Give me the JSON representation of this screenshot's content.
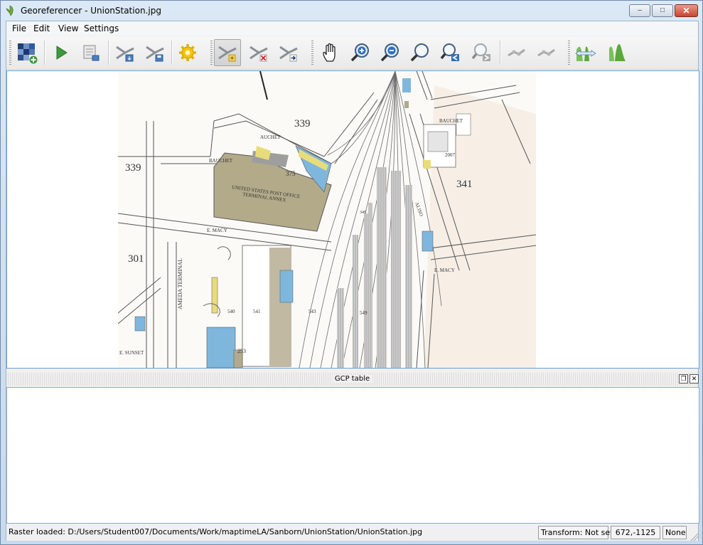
{
  "window": {
    "title": "Georeferencer - UnionStation.jpg",
    "controls": {
      "minimize": "‒",
      "maximize": "□",
      "close": "✕"
    }
  },
  "menubar": {
    "items": [
      "File",
      "Edit",
      "View",
      "Settings"
    ]
  },
  "toolbar": {
    "buttons": [
      {
        "icon": "open-raster-icon"
      },
      {
        "icon": "start-georeferencing-icon"
      },
      {
        "icon": "generate-gdal-script-icon"
      },
      {
        "icon": "load-gcp-points-icon"
      },
      {
        "icon": "save-gcp-points-icon"
      },
      {
        "icon": "transformation-settings-icon"
      },
      {
        "icon": "add-point-icon",
        "active": true
      },
      {
        "icon": "delete-point-icon"
      },
      {
        "icon": "move-gcp-point-icon"
      },
      {
        "icon": "pan-icon"
      },
      {
        "icon": "zoom-in-icon"
      },
      {
        "icon": "zoom-out-icon"
      },
      {
        "icon": "zoom-to-layer-icon"
      },
      {
        "icon": "zoom-last-icon"
      },
      {
        "icon": "zoom-next-icon"
      },
      {
        "icon": "link-georeferencer-to-qgis-icon"
      },
      {
        "icon": "link-qgis-to-georeferencer-icon"
      },
      {
        "icon": "full-histogram-stretch-icon"
      },
      {
        "icon": "local-histogram-stretch-icon"
      }
    ]
  },
  "map": {
    "labels": [
      "339",
      "339",
      "341",
      "301",
      "BAUCHET",
      "AUCHET",
      "BAUCHET",
      "UNITED STATES POST OFFICE",
      "TERMINAL ANNEX",
      "375",
      "E. MACY",
      "2007",
      "ALISO",
      "253",
      "349",
      "540",
      "541",
      "543",
      "549",
      "AMEDA TERMINAL",
      "E. SUNSET",
      "E. MACY"
    ]
  },
  "dock": {
    "title": "GCP table",
    "float_glyph": "❐",
    "close_glyph": "✕"
  },
  "status": {
    "message": "Raster loaded: D:/Users/Student007/Documents/Work/maptimeLA/Sanborn/UnionStation/UnionStation.jpg",
    "transform": "Transform: Not set",
    "coordinates": "672,-1125",
    "crs": "None"
  },
  "colors": {
    "water_blue": "#7fb7dc",
    "building_tan": "#b3aa8a",
    "yellow": "#e8dc7a",
    "selection_blue": "#6aa0d6"
  }
}
